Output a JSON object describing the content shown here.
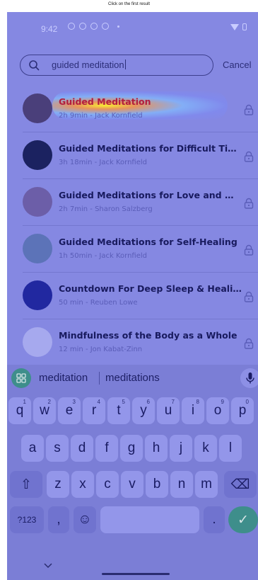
{
  "caption": "Click on the first result",
  "status_bar": {
    "time": "9:42"
  },
  "search": {
    "query": "guided meditation",
    "cancel_label": "Cancel"
  },
  "results": [
    {
      "title": "Guided Meditation",
      "subtitle": "2h 9min - Jack Kornfield",
      "thumb": "#4a3f7a"
    },
    {
      "title": "Guided Meditations for Difficult Times",
      "subtitle": "3h 18min - Jack Kornfield",
      "thumb": "#1b2260"
    },
    {
      "title": "Guided Meditations for Love and Wi...",
      "subtitle": "2h 7min - Sharon Salzberg",
      "thumb": "#6c5ea8"
    },
    {
      "title": "Guided Meditations for Self-Healing",
      "subtitle": "1h 50min - Jack Kornfield",
      "thumb": "#5c73b8"
    },
    {
      "title": "Countdown For Deep Sleep & Healing",
      "subtitle": "50 min - Reuben Lowe",
      "thumb": "#2128a0"
    },
    {
      "title": "Mindfulness of the Body as a Whole",
      "subtitle": "12 min - Jon Kabat-Zinn",
      "thumb": "#a6a9ee"
    }
  ],
  "keyboard": {
    "suggestions": [
      "meditation",
      "meditations"
    ],
    "row1": [
      {
        "k": "q",
        "n": "1"
      },
      {
        "k": "w",
        "n": "2"
      },
      {
        "k": "e",
        "n": "3"
      },
      {
        "k": "r",
        "n": "4"
      },
      {
        "k": "t",
        "n": "5"
      },
      {
        "k": "y",
        "n": "6"
      },
      {
        "k": "u",
        "n": "7"
      },
      {
        "k": "i",
        "n": "8"
      },
      {
        "k": "o",
        "n": "9"
      },
      {
        "k": "p",
        "n": "0"
      }
    ],
    "row2": [
      "a",
      "s",
      "d",
      "f",
      "g",
      "h",
      "j",
      "k",
      "l"
    ],
    "row3": [
      "z",
      "x",
      "c",
      "v",
      "b",
      "n",
      "m"
    ],
    "sym_label": "?123",
    "comma": ",",
    "period": ".",
    "emoji": "☺",
    "shift": "⇧",
    "backspace": "⌫",
    "enter": "✓"
  },
  "colors": {
    "overlay": "#8588e2",
    "accent": "#3e8e8b",
    "highlight_text": "#b21d3d"
  }
}
